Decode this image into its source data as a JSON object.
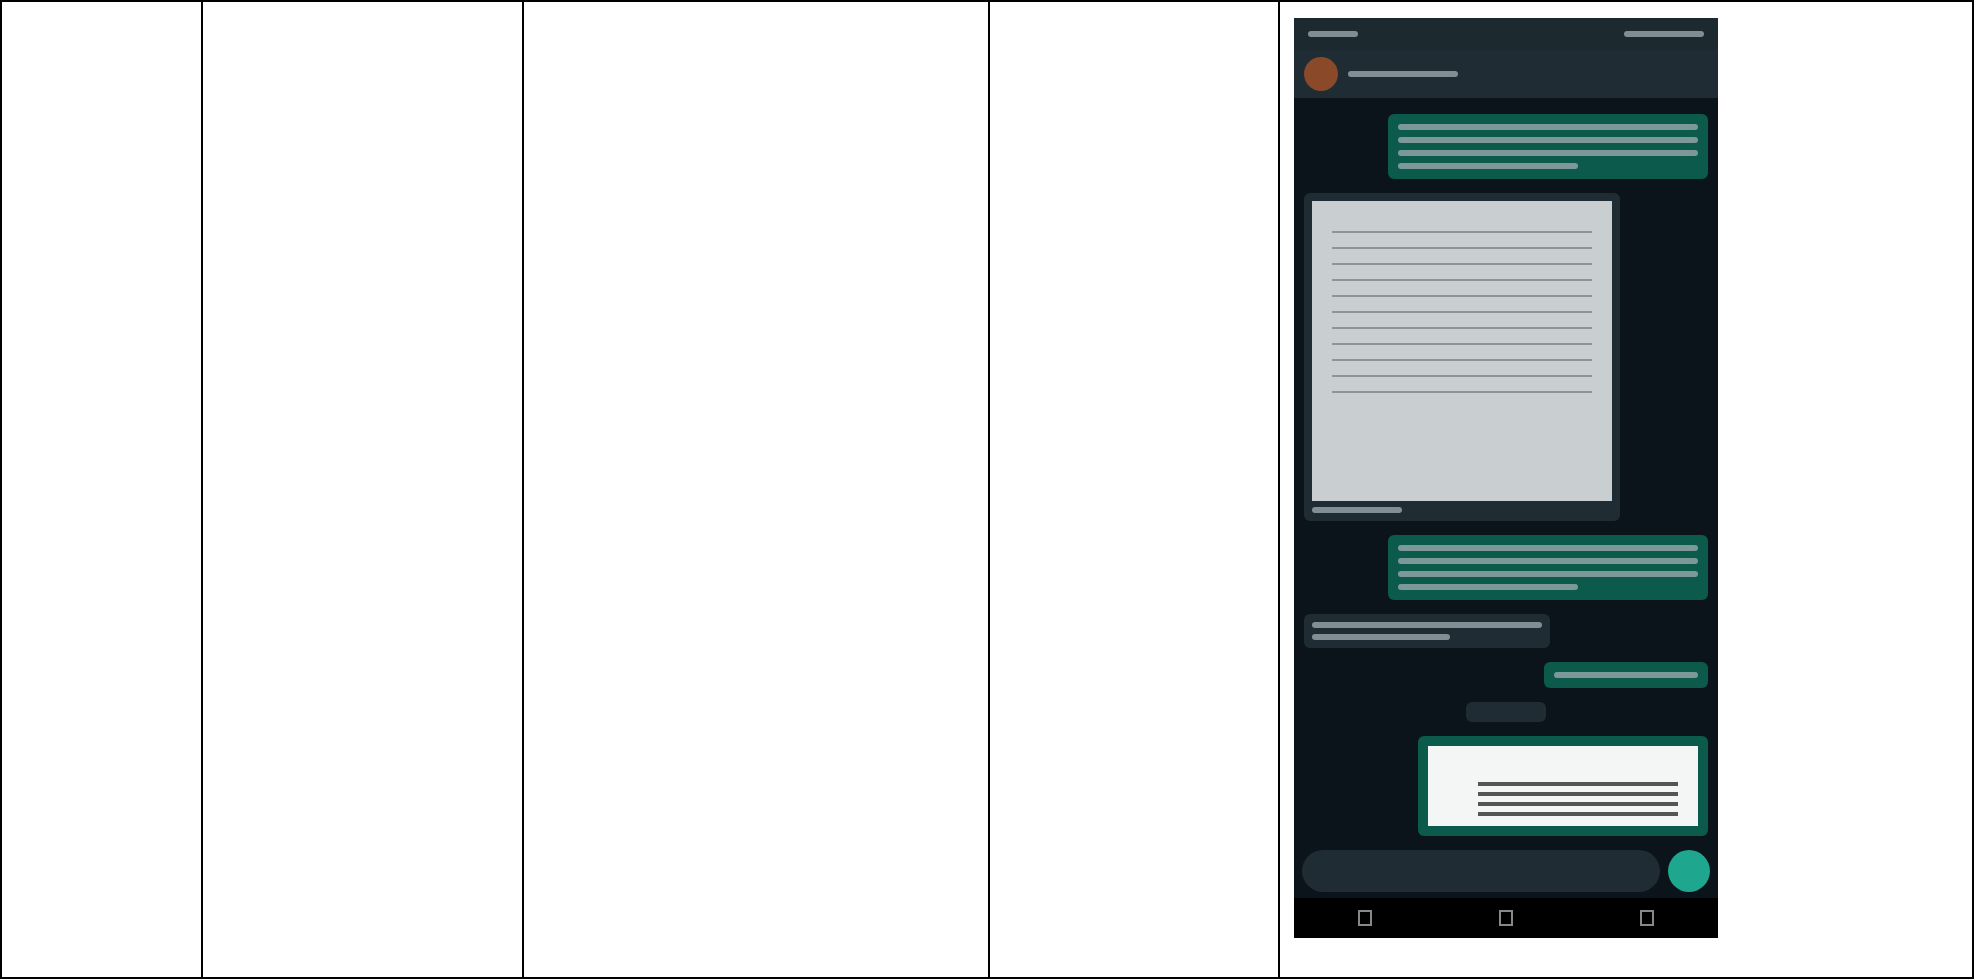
{
  "table": {
    "cells": [
      {
        "kind": "empty"
      },
      {
        "kind": "empty"
      },
      {
        "kind": "empty"
      },
      {
        "kind": "empty"
      },
      {
        "kind": "phone-screenshot"
      }
    ]
  },
  "chat": {
    "messages": [
      {
        "kind": "outgoing-text"
      },
      {
        "kind": "incoming-image"
      },
      {
        "kind": "outgoing-text"
      },
      {
        "kind": "incoming-text"
      },
      {
        "kind": "outgoing-short"
      },
      {
        "kind": "date-chip"
      },
      {
        "kind": "outgoing-image"
      }
    ]
  }
}
